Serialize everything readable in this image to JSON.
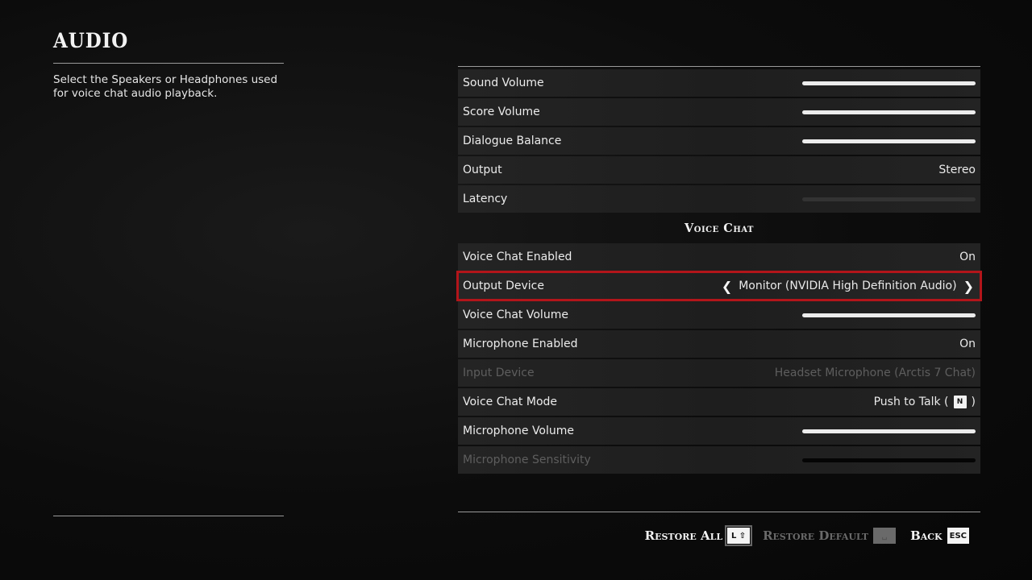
{
  "page": {
    "title": "AUDIO",
    "description": "Select the Speakers or Headphones used for voice chat audio playback."
  },
  "audio_settings": [
    {
      "label": "Sound Volume",
      "type": "slider",
      "level": 1.0
    },
    {
      "label": "Score Volume",
      "type": "slider",
      "level": 1.0
    },
    {
      "label": "Dialogue Balance",
      "type": "slider",
      "level": 1.0
    },
    {
      "label": "Output",
      "type": "text",
      "value": "Stereo"
    },
    {
      "label": "Latency",
      "type": "slider",
      "level": 0.0,
      "disabled_track": true
    }
  ],
  "voice_chat": {
    "heading": "Voice Chat",
    "items": [
      {
        "label": "Voice Chat Enabled",
        "type": "text",
        "value": "On"
      },
      {
        "label": "Output Device",
        "type": "selector",
        "value": "Monitor (NVIDIA High Definition Audio)",
        "selected": true
      },
      {
        "label": "Voice Chat Volume",
        "type": "slider",
        "level": 1.0
      },
      {
        "label": "Microphone Enabled",
        "type": "text",
        "value": "On"
      },
      {
        "label": "Input Device",
        "type": "text",
        "value": "Headset Microphone (Arctis 7 Chat)",
        "disabled": true
      },
      {
        "label": "Voice Chat Mode",
        "type": "keybind",
        "value": "Push to Talk (",
        "key": "N",
        "suffix": ")"
      },
      {
        "label": "Microphone Volume",
        "type": "slider",
        "level": 1.0
      },
      {
        "label": "Microphone Sensitivity",
        "type": "slider",
        "level": 0.0,
        "disabled": true,
        "black_track": true
      }
    ]
  },
  "footer": {
    "restore_all": "Restore All",
    "restore_all_key": "L ⇧",
    "restore_default": "Restore Default",
    "restore_default_key": "␣",
    "back": "Back",
    "back_key": "ESC"
  },
  "colors": {
    "selection_outline": "#b3151a",
    "background": "#0b0b0b"
  }
}
